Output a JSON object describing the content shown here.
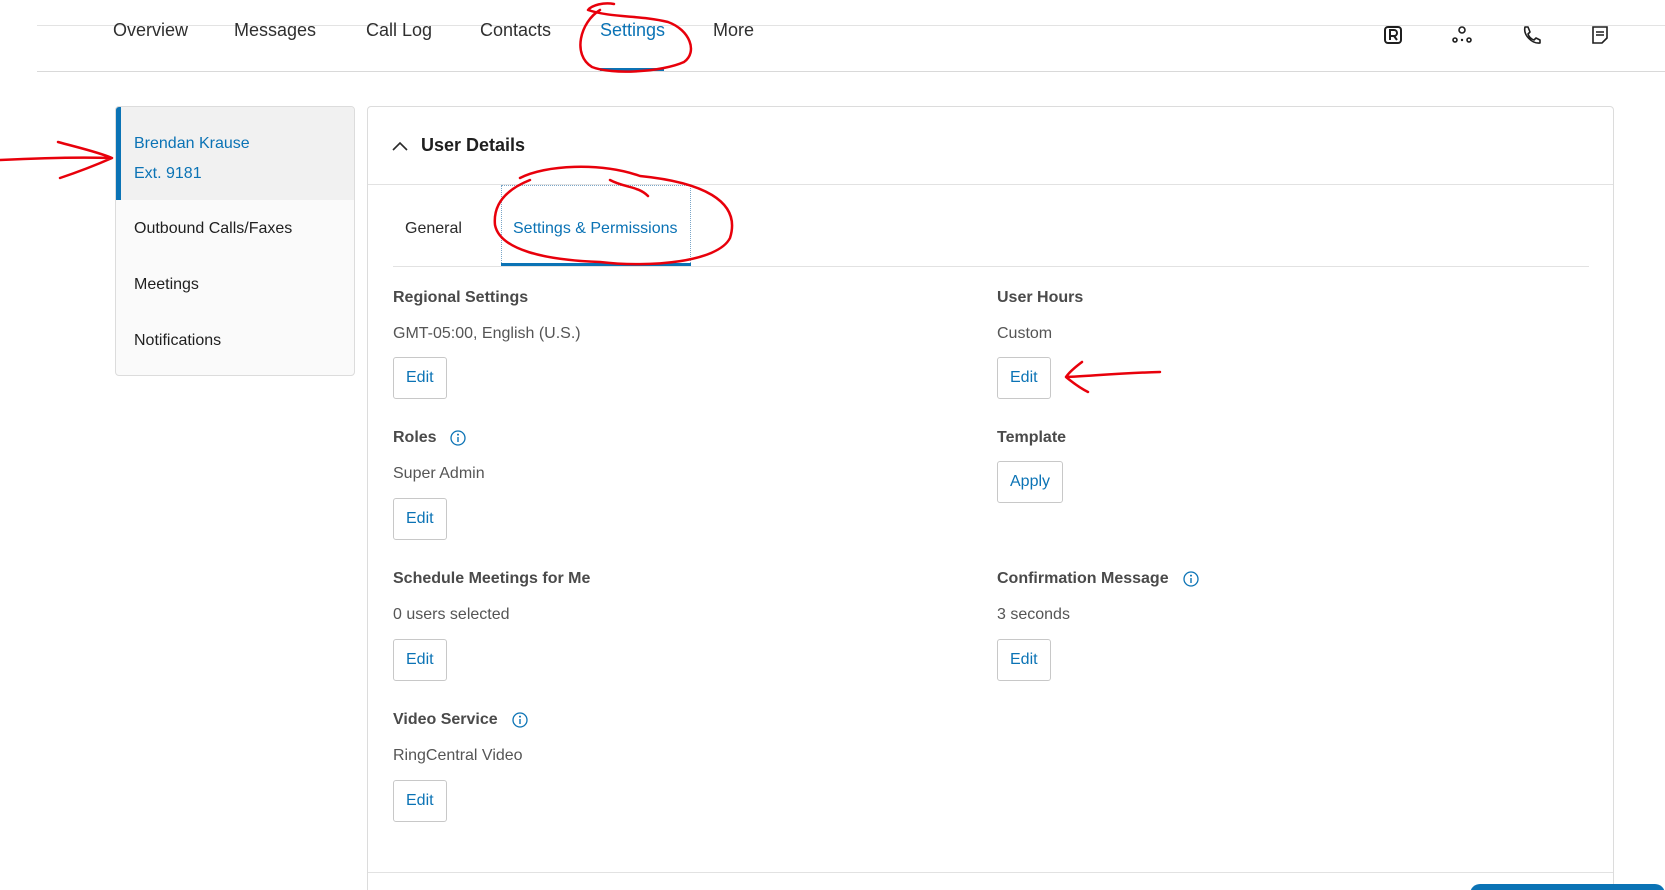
{
  "top_nav": {
    "tabs": [
      {
        "label": "Overview"
      },
      {
        "label": "Messages"
      },
      {
        "label": "Call Log"
      },
      {
        "label": "Contacts"
      },
      {
        "label": "Settings",
        "active": true
      },
      {
        "label": "More"
      }
    ],
    "utility_icons": [
      "ringcentral-app-icon",
      "integrations-icon",
      "phone-icon",
      "notes-icon"
    ]
  },
  "sidebar": {
    "user": {
      "name": "Brendan Krause",
      "extension": "Ext. 9181"
    },
    "items": [
      {
        "label": "Outbound Calls/Faxes"
      },
      {
        "label": "Meetings"
      },
      {
        "label": "Notifications"
      }
    ]
  },
  "panel": {
    "title": "User Details",
    "tabs": [
      {
        "label": "General"
      },
      {
        "label": "Settings & Permissions",
        "active": true
      }
    ],
    "sections": {
      "regional": {
        "label": "Regional Settings",
        "value": "GMT-05:00, English (U.S.)",
        "button": "Edit"
      },
      "user_hours": {
        "label": "User Hours",
        "value": "Custom",
        "button": "Edit"
      },
      "roles": {
        "label": "Roles",
        "value": "Super Admin",
        "button": "Edit"
      },
      "template": {
        "label": "Template",
        "button": "Apply"
      },
      "schedule": {
        "label": "Schedule Meetings for Me",
        "value": "0 users selected",
        "button": "Edit"
      },
      "confirmation": {
        "label": "Confirmation Message",
        "value": "3 seconds",
        "button": "Edit"
      },
      "video": {
        "label": "Video Service",
        "value": "RingCentral Video",
        "button": "Edit"
      }
    }
  },
  "colors": {
    "accent": "#0b73b5",
    "annotation": "#e8000b"
  }
}
